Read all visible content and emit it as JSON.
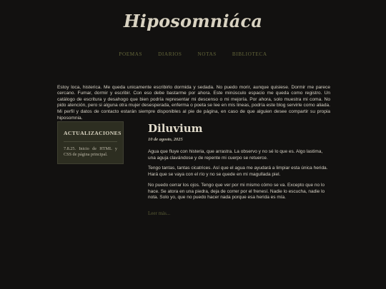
{
  "site": {
    "title": "Hiposomniáca"
  },
  "nav": {
    "items": [
      {
        "label": "POEMAS"
      },
      {
        "label": "DIARIOS"
      },
      {
        "label": "NOTAS"
      },
      {
        "label": "BIBLIOTECA"
      }
    ]
  },
  "intro": {
    "text": "Estoy loca, histerica. Me queda unicamente escribirlo dormida y sedada. No puedo morir, aunque quisiese. Dormir me parece cercano. Fumar, dormir y escribir. Con eso debe bastarme por ahora. Este minúsculo espacio me queda como registro. Un catálogo de escritura y desahogo que bien podría representar mi descenso o mi mejoría. Por ahora, solo muestra mi coma. No pido atención, pero si alguna otra mujer desesperada, enferma o poeta se lee en mis lineas, podría este blog servirle como aliada. Mi perfil y datos de contacto estarán siempre disponibles al pie de página, en caso de que alguien desee compartir su propia hiposomnia."
  },
  "sidebar": {
    "heading": "ACTUALIZACIONES",
    "entries": [
      {
        "text": "7.8.25. Inicio de HTML y CSS de página principal."
      }
    ]
  },
  "post": {
    "title": "Diluvium",
    "date": "10 de agosto, 2025",
    "paragraphs": [
      "Agua que fluye con histeria, que arrastra. La observo y no sé lo que es. Algo lastima, una aguja clavándose y de repente mi cuerpo se retuerce.",
      "Tengo tantas, tantas cicatrices. Así que el agua me ayudará a limpiar esta única herida. Hará que se vaya con el río y no se quede en mi magullada piel.",
      "No puedo cerrar los ojos. Tengo que ver por mi mismo cómo se va. Excepto que no lo hace. Se atora en una piedra, deja de correr por el frenesí. Nadie lo escucha, nadie lo nota. Solo yo, que no puedo hacer nada porque esa herida es mía."
    ],
    "read_more": "Leer más..."
  }
}
